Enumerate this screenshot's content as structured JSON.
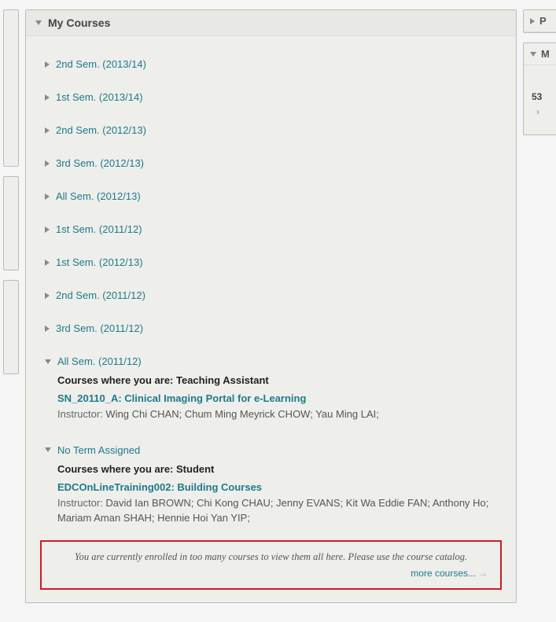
{
  "module": {
    "title": "My Courses"
  },
  "terms": [
    {
      "label": "2nd Sem. (2013/14)",
      "expanded": false
    },
    {
      "label": "1st Sem. (2013/14)",
      "expanded": false
    },
    {
      "label": "2nd Sem. (2012/13)",
      "expanded": false
    },
    {
      "label": "3rd Sem. (2012/13)",
      "expanded": false
    },
    {
      "label": "All Sem. (2012/13)",
      "expanded": false
    },
    {
      "label": "1st Sem. (2011/12)",
      "expanded": false
    },
    {
      "label": "1st Sem. (2012/13)",
      "expanded": false
    },
    {
      "label": "2nd Sem. (2011/12)",
      "expanded": false
    },
    {
      "label": "3rd Sem. (2011/12)",
      "expanded": false
    },
    {
      "label": "All Sem. (2011/12)",
      "expanded": true
    },
    {
      "label": "No Term Assigned",
      "expanded": true
    }
  ],
  "section_all_2011_12": {
    "role_line": "Courses where you are: Teaching Assistant",
    "course": "SN_20110_A: Clinical Imaging Portal for e-Learning",
    "instructor_label": "Instructor:",
    "instructors": "Wing Chi CHAN;  Chum Ming Meyrick CHOW;  Yau Ming LAI;"
  },
  "section_noterm": {
    "role_line": "Courses where you are: Student",
    "course": "EDCOnLineTraining002: Building Courses",
    "instructor_label": "Instructor:",
    "instructors": "David Ian BROWN;  Chi Kong CHAU;  Jenny EVANS;  Kit Wa Eddie FAN;  Anthony Ho;  Mariam Aman SHAH;  Hennie Hoi Yan YIP;"
  },
  "notice": {
    "text": "You are currently enrolled in too many courses to view them all here. Please use the course catalog.",
    "more": "more courses..."
  },
  "right": {
    "panel1_title": "P",
    "panel2_title": "M",
    "body_num": "53"
  }
}
